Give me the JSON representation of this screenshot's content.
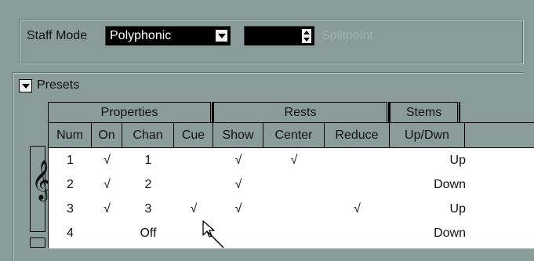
{
  "staff": {
    "label": "Staff Mode",
    "mode_value": "Polyphonic",
    "spinner_value": "",
    "splitpoint_label": "Splitpoint"
  },
  "presets": {
    "label": "Presets"
  },
  "groups": {
    "properties": "Properties",
    "rests": "Rests",
    "stems": "Stems"
  },
  "columns": [
    "Num",
    "On",
    "Chan",
    "Cue",
    "Show",
    "Center",
    "Reduce",
    "Up/Dwn"
  ],
  "rows": [
    {
      "num": "1",
      "on": "√",
      "chan": "1",
      "cue": "",
      "show": "√",
      "center": "√",
      "reduce": "",
      "updwn": "Up"
    },
    {
      "num": "2",
      "on": "√",
      "chan": "2",
      "cue": "",
      "show": "√",
      "center": "",
      "reduce": "",
      "updwn": "Down"
    },
    {
      "num": "3",
      "on": "√",
      "chan": "3",
      "cue": "√",
      "show": "√",
      "center": "",
      "reduce": "√",
      "updwn": "Up"
    },
    {
      "num": "4",
      "on": "",
      "chan": "Off",
      "cue": "",
      "show": "",
      "center": "",
      "reduce": "",
      "updwn": "Down"
    }
  ],
  "clef_glyph": "𝄞",
  "icons": {
    "mode_dropdown": "chevron-down-icon",
    "presets_toggle": "chevron-down-icon",
    "spinner": "spinner-arrows-icon",
    "cursor": "mouse-pointer-icon"
  },
  "colors": {
    "panel_bg": "#8a9c99",
    "field_bg": "#000000",
    "table_bg": "#ffffff"
  }
}
